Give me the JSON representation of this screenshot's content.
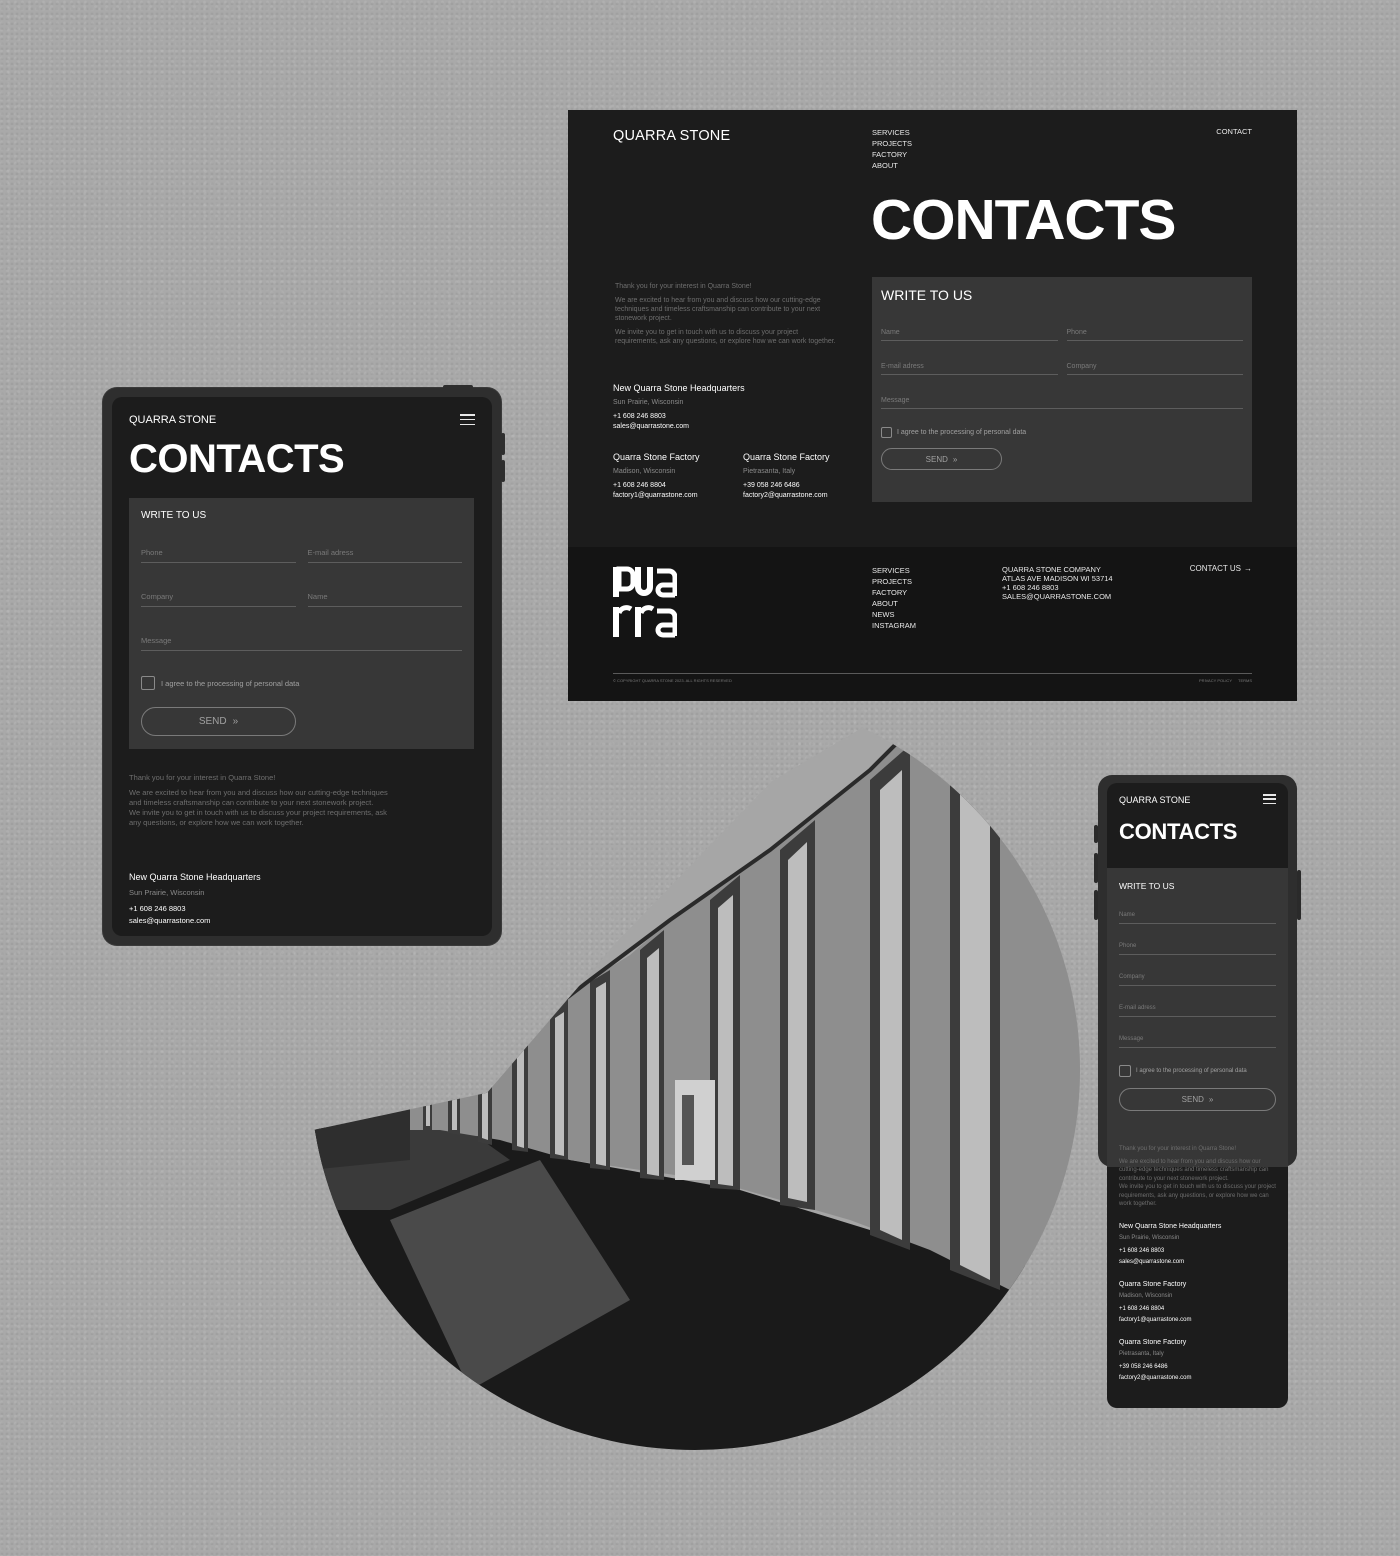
{
  "colors": {
    "background": "#a9a9a9",
    "screen": "#1c1c1c",
    "form_panel": "#373737",
    "footer": "#141414",
    "muted_text": "#6e6e6e",
    "text": "#ffffff"
  },
  "brand": "QUARRA STONE",
  "page_title": "CONTACTS",
  "nav": [
    "SERVICES",
    "PROJECTS",
    "FACTORY",
    "ABOUT"
  ],
  "nav_contact": "CONTACT",
  "icons": {
    "menu": "hamburger-icon",
    "send": "double-chevron-right-icon",
    "contact_arrow": "arrow-right-icon"
  },
  "intro": {
    "thanks": "Thank you for your interest in Quarra Stone!",
    "p1": "We are excited to hear from you and discuss how our cutting-edge techniques and timeless craftsmanship can contribute to your next stonework project.",
    "p2": "We invite you to get in touch with us to discuss your project requirements, ask any questions, or explore how we can work together."
  },
  "locations": [
    {
      "title": "New Quarra Stone Headquarters",
      "city": "Sun Prairie, Wisconsin",
      "phone": "+1 608 246 8803",
      "email": "sales@quarrastone.com"
    },
    {
      "title": "Quarra Stone Factory",
      "city": "Madison, Wisconsin",
      "phone": "+1 608 246 8804",
      "email": "factory1@quarrastone.com"
    },
    {
      "title": "Quarra Stone Factory",
      "city": "Pietrasanta, Italy",
      "phone": "+39 058 246 6486",
      "email": "factory2@quarrastone.com"
    }
  ],
  "form": {
    "title": "WRITE TO US",
    "fields": {
      "name": {
        "placeholder": "Name",
        "value": ""
      },
      "phone": {
        "placeholder": "Phone",
        "value": ""
      },
      "email": {
        "placeholder": "E-mail adress",
        "value": ""
      },
      "company": {
        "placeholder": "Company",
        "value": ""
      },
      "message": {
        "placeholder": "Message",
        "value": ""
      }
    },
    "agree_label": "I agree to the processing of personal data",
    "agree_checked": false,
    "send_label": "SEND",
    "send_glyph": "»"
  },
  "footer": {
    "logo_top": "qua",
    "logo_bottom": "rra",
    "nav": [
      "SERVICES",
      "PROJECTS",
      "FACTORY",
      "ABOUT",
      "NEWS",
      "INSTAGRAM"
    ],
    "company": [
      "QUARRA STONE COMPANY",
      "ATLAS AVE MADISON WI 53714",
      "+1 608 246 8803",
      "SALES@QUARRASTONE.COM"
    ],
    "contact_us": "CONTACT US",
    "arrow_glyph": "→",
    "copyright": "© COPYRIGHT QUARRA STONE 2023. ALL RIGHTS RESERVED",
    "privacy": "PRIVACY POLICY",
    "terms": "TERMS"
  }
}
